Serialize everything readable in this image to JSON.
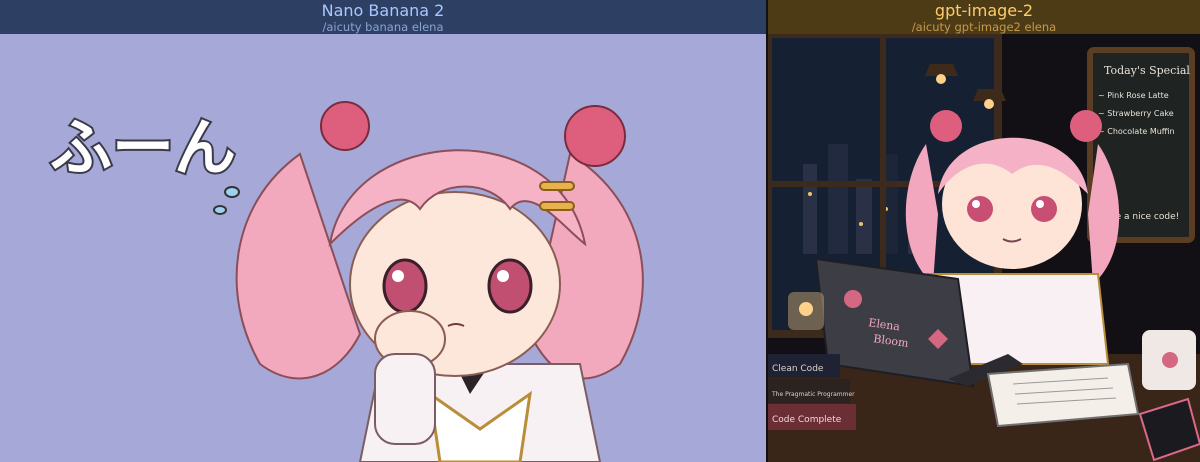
{
  "panels": [
    {
      "title": "Nano Banana 2",
      "command": "/aicuty banana elena",
      "artwork": {
        "caption_text": "ふーん",
        "header_color": "#2d3f63",
        "background_color": "#a6a9d7"
      }
    },
    {
      "title": "gpt-image-2",
      "command": "/aicuty gpt-image2 elena",
      "artwork": {
        "chalkboard_lines": [
          "Today's Special",
          "~ Pink Rose Latte",
          "~ Strawberry Cake",
          "~ Chocolate Muffin",
          "Have a nice code!"
        ],
        "laptop_text": [
          "Elena",
          "Bloom"
        ],
        "book_titles": [
          "Clean Code",
          "The Pragmatic Programmer",
          "Code Complete"
        ],
        "header_color": "#4d3b16"
      }
    }
  ]
}
